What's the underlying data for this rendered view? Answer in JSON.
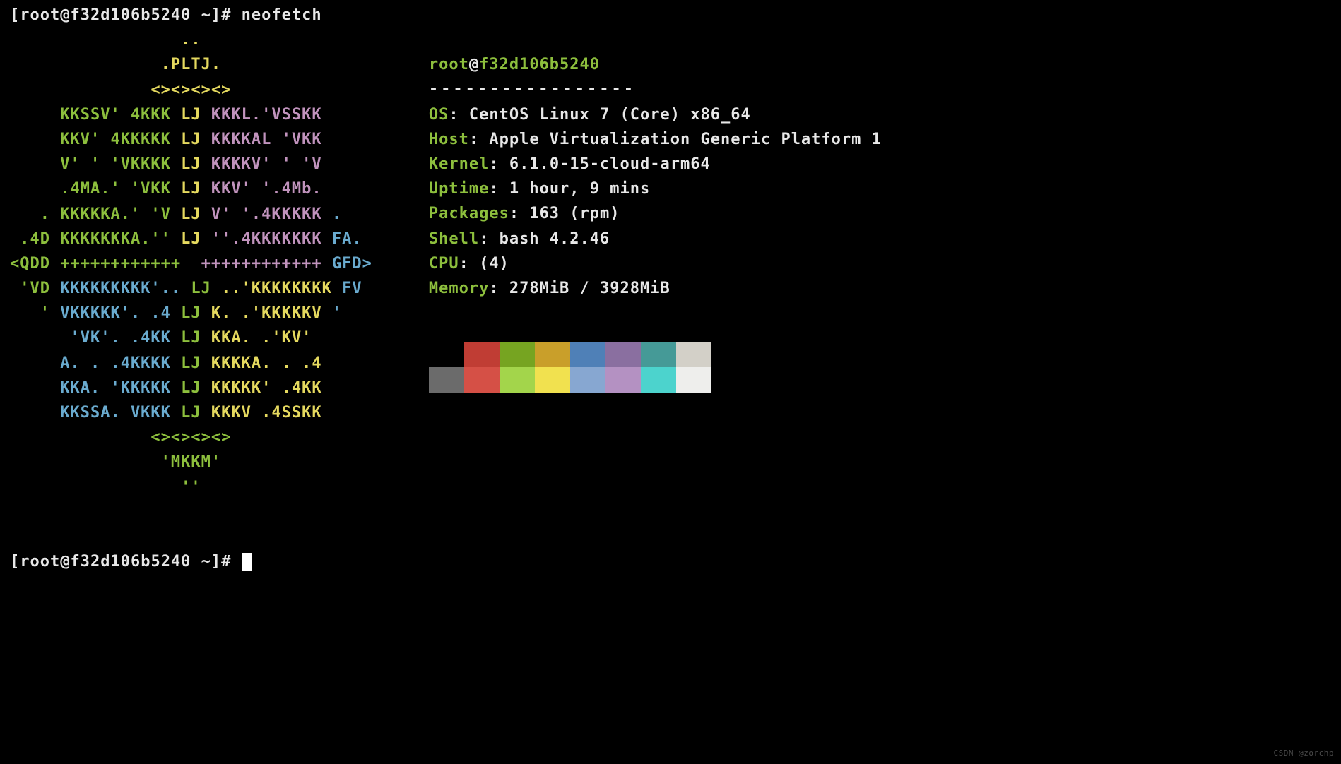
{
  "prompt1": {
    "bracket_open": "[",
    "user": "root",
    "at": "@",
    "host": "f32d106b5240",
    "path": " ~]# ",
    "command": "neofetch"
  },
  "logo": {
    "l01_a": "                 ..",
    "l02_a": "               .PLTJ.",
    "l03_a": "              <><><><>",
    "l04_g": "     KKSSV' 4KKK",
    "l04_y": " LJ",
    "l04_p": " KKKL.'VSSKK",
    "l05_g": "     KKV' 4KKKKK",
    "l05_y": " LJ",
    "l05_p": " KKKKAL 'VKK",
    "l06_g": "     V' ' 'VKKKK",
    "l06_y": " LJ",
    "l06_p": " KKKKV' ' 'V",
    "l07_g": "     .4MA.' 'VKK",
    "l07_y": " LJ",
    "l07_p": " KKV' '.4Mb.",
    "l08_g": "   .",
    "l08_g2": " KKKKKA.' 'V",
    "l08_y": " LJ",
    "l08_p": " V' '.4KKKKK",
    "l08_b": " .",
    "l09_g": " .4D",
    "l09_g2": " KKKKKKKA.''",
    "l09_y": " LJ",
    "l09_p": " ''.4KKKKKKK",
    "l09_b": " FA.",
    "l10_g": "<QDD",
    "l10_g2": " ++++++++++++",
    "l10_sp": "  ",
    "l10_p": "++++++++++++",
    "l10_b": " GFD>",
    "l11_g": " 'VD",
    "l11_b2": " KKKKKKKKK'..",
    "l11_y": " LJ",
    "l11_y2": " ..'KKKKKKKK",
    "l11_b": " FV",
    "l12_g": "   '",
    "l12_b2": " VKKKKK'. .4",
    "l12_y": " LJ",
    "l12_y2": " K. .'KKKKKV",
    "l12_b": " '",
    "l13_b": "      'VK'. .4KK",
    "l13_y": " LJ",
    "l13_y2": " KKA. .'KV'",
    "l14_b": "     A. . .4KKKK",
    "l14_y": " LJ",
    "l14_y2": " KKKKA. . .4",
    "l15_b": "     KKA. 'KKKKK",
    "l15_y": " LJ",
    "l15_y2": " KKKKK' .4KK",
    "l16_b": "     KKSSA. VKKK",
    "l16_y": " LJ",
    "l16_y2": " KKKV .4SSKK",
    "l17_g": "              <><><><>",
    "l18_g": "               'MKKM'",
    "l19_g": "                 ''"
  },
  "info": {
    "title_user": "root",
    "title_at": "@",
    "title_host": "f32d106b5240",
    "dashes": "-----------------",
    "os_label": "OS",
    "os_value": ": CentOS Linux 7 (Core) x86_64",
    "host_label": "Host",
    "host_value": ": Apple Virtualization Generic Platform 1",
    "kernel_label": "Kernel",
    "kernel_value": ": 6.1.0-15-cloud-arm64",
    "uptime_label": "Uptime",
    "uptime_value": ": 1 hour, 9 mins",
    "packages_label": "Packages",
    "packages_value": ": 163 (rpm)",
    "shell_label": "Shell",
    "shell_value": ": bash 4.2.46",
    "cpu_label": "CPU",
    "cpu_value": ": (4)",
    "memory_label": "Memory",
    "memory_value": ": 278MiB / 3928MiB"
  },
  "palette": {
    "row1": [
      "#000000",
      "#c03d34",
      "#76a421",
      "#c99f2a",
      "#4f80b7",
      "#8a6fa0",
      "#459a97",
      "#d3d0c8"
    ],
    "row2": [
      "#6b6b6b",
      "#d55046",
      "#a3d54b",
      "#f1e14f",
      "#87a7d1",
      "#b491c2",
      "#4cd3cd",
      "#eeeeec"
    ]
  },
  "prompt2": {
    "bracket_open": "[",
    "user": "root",
    "at": "@",
    "host": "f32d106b5240",
    "path": " ~]# "
  },
  "watermark": "CSDN @zorchp"
}
